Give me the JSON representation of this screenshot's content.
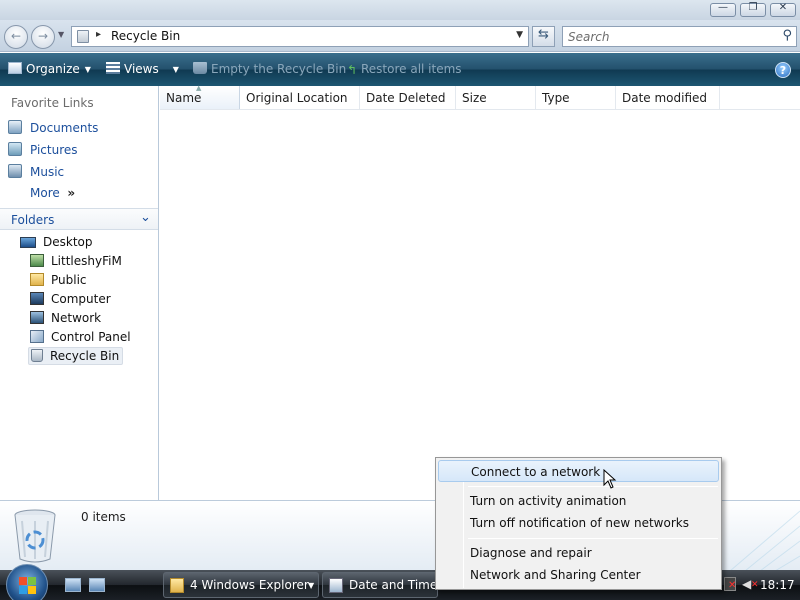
{
  "window": {
    "minimize_glyph": "—",
    "maximize_glyph": "❐",
    "close_glyph": "✕"
  },
  "nav": {
    "back_glyph": "←",
    "forward_glyph": "→",
    "address_separator": "▸",
    "address_text": "Recycle Bin",
    "address_dropdown": "▼",
    "refresh_glyph": "⇆",
    "search_placeholder": "Search",
    "search_icon": "⚲"
  },
  "toolbar": {
    "organize": "Organize",
    "views": "Views",
    "empty": "Empty the Recycle Bin",
    "restore": "Restore all items",
    "help": "?",
    "dropdown_glyph": "▼"
  },
  "navpane": {
    "favorites_header": "Favorite Links",
    "favorites": [
      "Documents",
      "Pictures",
      "Music"
    ],
    "more": "More",
    "more_glyph": "»",
    "folders_header": "Folders",
    "folders_chevron": "⌄",
    "tree": [
      "Desktop",
      "LittleshyFiM",
      "Public",
      "Computer",
      "Network",
      "Control Panel",
      "Recycle Bin"
    ]
  },
  "columns": [
    "Name",
    "Original Location",
    "Date Deleted",
    "Size",
    "Type",
    "Date modified"
  ],
  "details": {
    "item_count": "0 items"
  },
  "taskbar": {
    "explorer_count": "4",
    "explorer_label": "Windows Explorer",
    "datetime_label": "Date and Time",
    "clock": "18:17"
  },
  "context_menu": {
    "items": [
      "Connect to a network",
      "Turn on activity animation",
      "Turn off notification of new networks",
      "Diagnose and repair",
      "Network and Sharing Center"
    ]
  },
  "colors": {
    "toolbar": "#24516d",
    "link": "#1c4f9c",
    "menu_highlight": "#d6e7f9"
  }
}
